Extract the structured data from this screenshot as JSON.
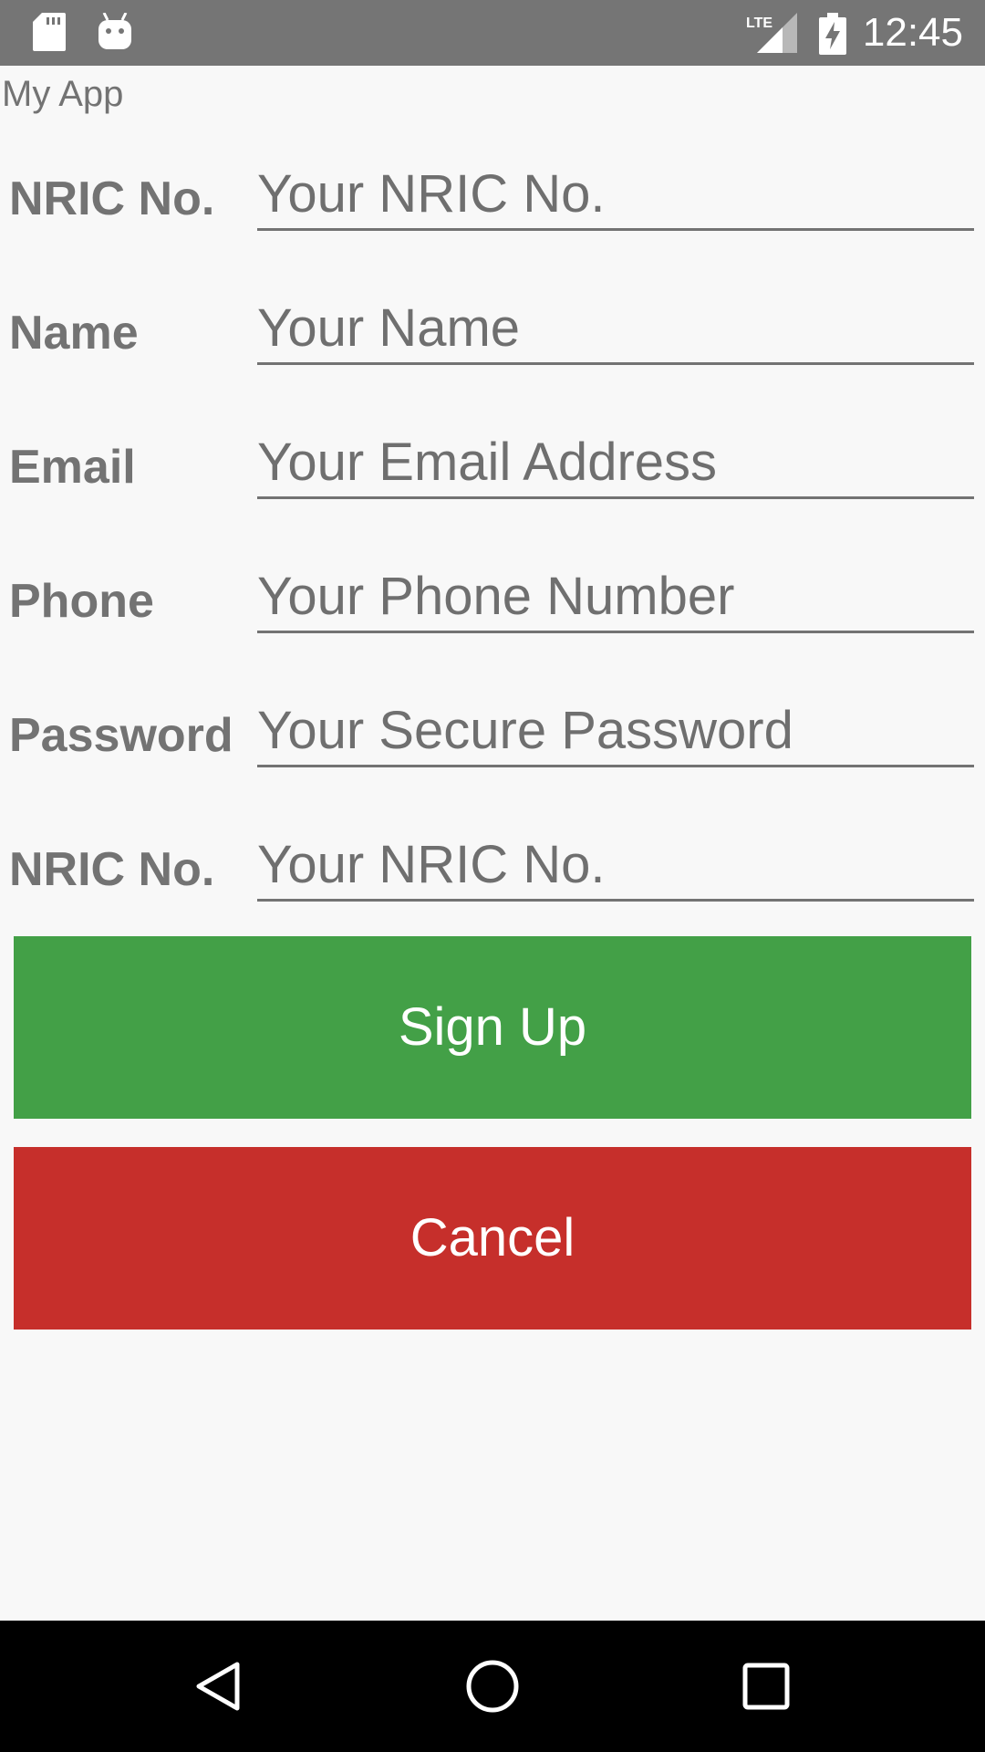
{
  "status_bar": {
    "time": "12:45",
    "network": "LTE",
    "icons": [
      "sd-card-icon",
      "android-icon",
      "signal-icon",
      "battery-charging-icon"
    ]
  },
  "app": {
    "title": "My App"
  },
  "form": {
    "fields": [
      {
        "label": "NRIC No.",
        "placeholder": "Your NRIC No.",
        "value": ""
      },
      {
        "label": "Name",
        "placeholder": "Your Name",
        "value": ""
      },
      {
        "label": "Email",
        "placeholder": "Your Email Address",
        "value": ""
      },
      {
        "label": "Phone",
        "placeholder": "Your Phone Number",
        "value": ""
      },
      {
        "label": "Password",
        "placeholder": "Your Secure Password",
        "value": ""
      },
      {
        "label": "NRIC No.",
        "placeholder": "Your NRIC No.",
        "value": ""
      }
    ]
  },
  "buttons": {
    "signup_label": "Sign Up",
    "cancel_label": "Cancel"
  },
  "colors": {
    "status_bar": "#757575",
    "signup": "#43a047",
    "cancel": "#c62f2b",
    "nav_bar": "#000000",
    "text": "#737373"
  },
  "nav": {
    "icons": [
      "back-icon",
      "home-icon",
      "recents-icon"
    ]
  }
}
